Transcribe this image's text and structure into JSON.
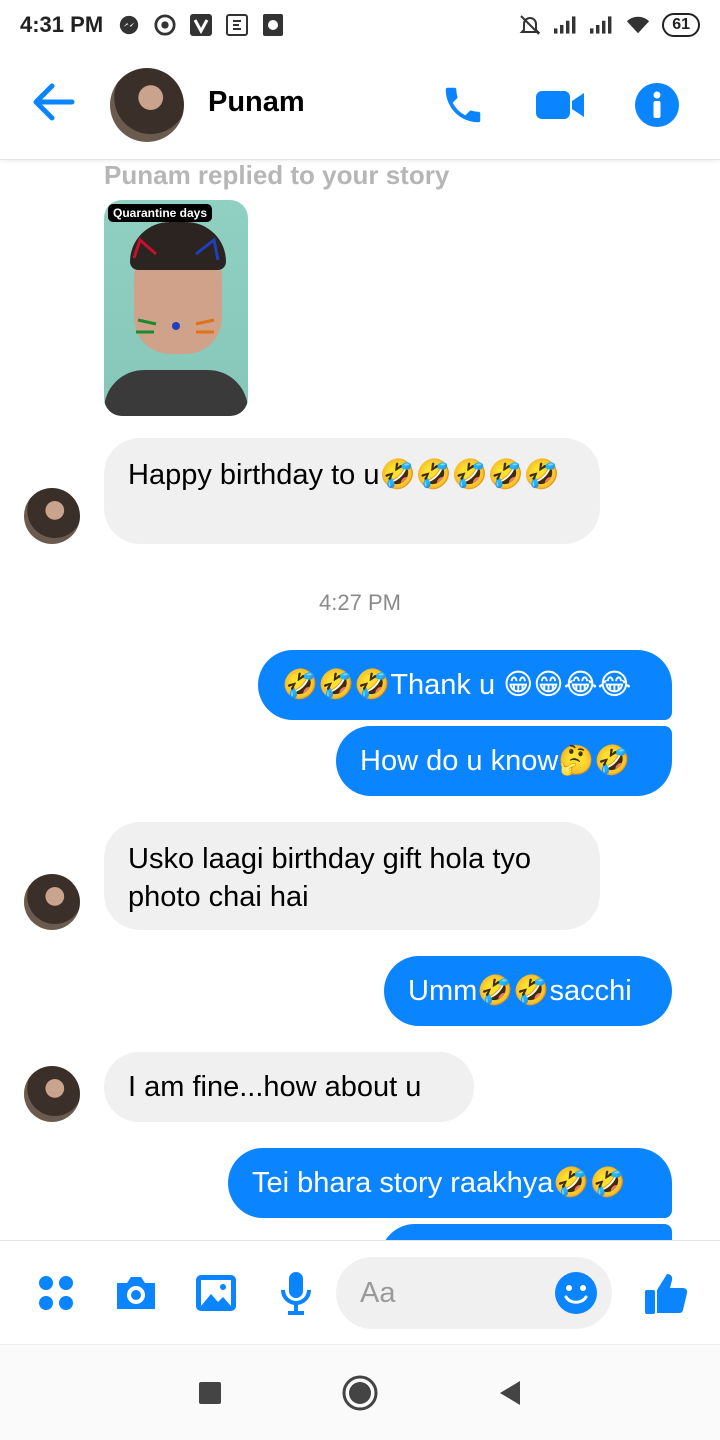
{
  "status_bar": {
    "time": "4:31 PM",
    "battery": "61",
    "icons_left": [
      "messenger-icon",
      "chrome-icon",
      "v-app-icon",
      "e-app-icon",
      "gallery-icon"
    ],
    "icons_right": [
      "silent-bell-icon",
      "signal-icon",
      "signal-icon",
      "wifi-icon",
      "battery-icon"
    ]
  },
  "header": {
    "contact_name": "Punam",
    "accent": "#0a84ff"
  },
  "chat": {
    "story_note": "Punam replied to your story",
    "story_tag": "Quarantine days",
    "messages": [
      {
        "dir": "in",
        "text": "Happy birthday to u🤣🤣🤣🤣🤣"
      },
      {
        "dir": "in",
        "text": "Usko laagi birthday gift hola tyo photo chai hai"
      },
      {
        "dir": "out",
        "text": "🤣🤣🤣Thank u 😁😁😂😂"
      },
      {
        "dir": "out",
        "text": "How do u know🤔🤣"
      },
      {
        "dir": "out",
        "text": "Umm🤣🤣sacchi"
      },
      {
        "dir": "in",
        "text": "I am fine...how about u"
      },
      {
        "dir": "out",
        "text": "Tei bhara story raakhya🤣🤣"
      }
    ],
    "timestamp": "4:27 PM",
    "bubble_out_color": "#0a84ff",
    "bubble_in_color": "#f0f0f0"
  },
  "composer": {
    "placeholder": "Aa"
  }
}
